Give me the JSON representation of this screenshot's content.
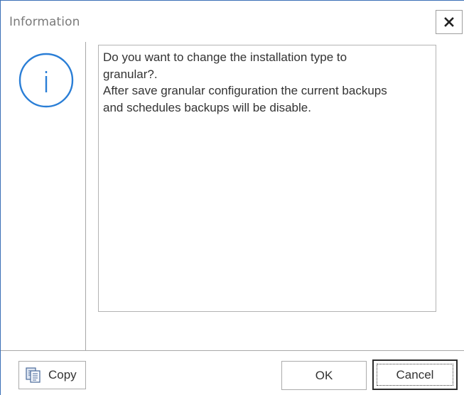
{
  "dialog": {
    "title": "Information",
    "close_label": "✕"
  },
  "icon": {
    "name": "info-icon",
    "color": "#2a7ed6"
  },
  "message": {
    "lines": [
      "Do you want to change the installation type to",
      "granular?.",
      "After save granular configuration the current backups",
      "and schedules backups will be disable."
    ]
  },
  "buttons": {
    "copy_label": "Copy",
    "ok_label": "OK",
    "cancel_label": "Cancel"
  }
}
